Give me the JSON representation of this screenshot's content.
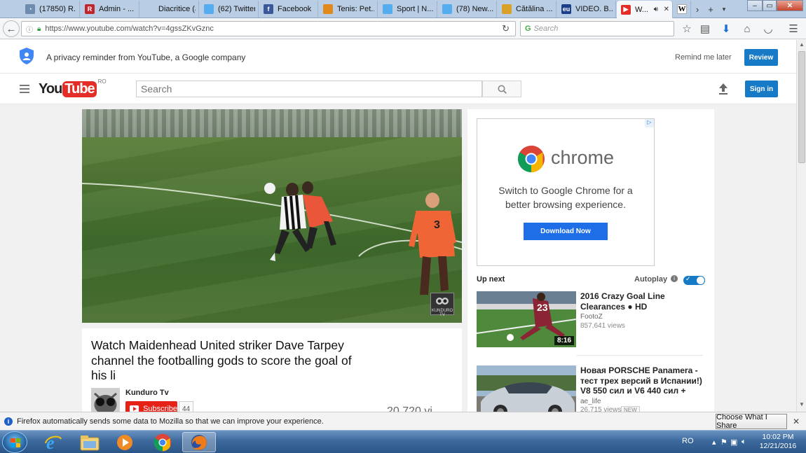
{
  "browser": {
    "tabs": [
      {
        "label": "(17850) R...",
        "color": "#6e8cb0",
        "glyph": "◔"
      },
      {
        "label": "Admin - ...",
        "color": "#c0272d",
        "glyph": "R"
      },
      {
        "label": "Diacritice (ăâî...",
        "color": "#b9cde4",
        "glyph": ""
      },
      {
        "label": "(62) Twitter",
        "color": "#55acee",
        "glyph": ""
      },
      {
        "label": "Facebook",
        "color": "#3b5998",
        "glyph": "f"
      },
      {
        "label": "Tenis: Pet...",
        "color": "#e08a1e",
        "glyph": ""
      },
      {
        "label": "Sport | N...",
        "color": "#55acee",
        "glyph": ""
      },
      {
        "label": "(78) New...",
        "color": "#55acee",
        "glyph": ""
      },
      {
        "label": "Cătălina ...",
        "color": "#d9a12a",
        "glyph": ""
      },
      {
        "label": "VIDEO. B...",
        "color": "#1c3f8a",
        "glyph": "eu"
      },
      {
        "label": "W...",
        "color": "#e52d27",
        "glyph": "▶"
      }
    ],
    "wiki_tab_glyph": "W",
    "url": "https://www.youtube.com/watch?v=4gssZKvGznc",
    "search_placeholder": "Search"
  },
  "privacy": {
    "message": "A privacy reminder from YouTube, a Google company",
    "remind_later": "Remind me later",
    "review": "Review"
  },
  "youtube": {
    "logo_you": "You",
    "logo_tube": "Tube",
    "logo_country": "RO",
    "search_placeholder": "Search",
    "sign_in": "Sign in"
  },
  "video": {
    "title": "Watch Maidenhead United striker Dave Tarpey channel the footballing gods to score the goal of his li",
    "channel": "Kunduro Tv",
    "subscribe": "Subscribe",
    "subscriber_count": "44",
    "view_count_partial": "20,720 vi",
    "watermark": "KUNDURO TV",
    "jersey_number": "3"
  },
  "ad": {
    "brand": "chrome",
    "text": "Switch to Google Chrome for a better browsing experience.",
    "button": "Download Now",
    "ad_choice": "▷"
  },
  "sidebar": {
    "up_next": "Up next",
    "autoplay": "Autoplay",
    "videos": [
      {
        "title": "2016 Crazy Goal Line Clearances ● HD",
        "channel": "FootoZ",
        "views": "857,641 views",
        "duration": "8:16",
        "jersey": "23"
      },
      {
        "title": "Новая PORSCHE Panamera - тест трех версий в Испании!) V8 550 сил и V6 440 сил +",
        "channel": "ae_life",
        "views": "26,715 views",
        "badge": "NEW"
      }
    ]
  },
  "notification": {
    "message": "Firefox automatically sends some data to Mozilla so that we can improve your experience.",
    "button": "Choose What I Share"
  },
  "taskbar": {
    "language": "RO",
    "time": "10:02 PM",
    "date": "12/21/2016"
  }
}
